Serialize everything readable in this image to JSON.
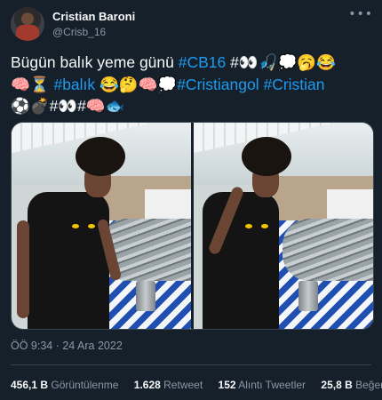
{
  "author": {
    "name": "Cristian Baroni",
    "handle": "@Crisb_16"
  },
  "menu": {
    "more_label": "•••"
  },
  "tweet": {
    "line1_text": "Bügün balık yeme günü ",
    "line1_tag": "#CB16",
    "line1_rest": " #👀🎣💭🥱😂",
    "line2_emoji": "🧠⏳",
    "line2_tags": "#balık",
    "line2_mid": " 😂🤔🧠💭",
    "line2_tags2": "#Cristiangol #Cristian",
    "line3": "⚽💣#👀#🧠🐟"
  },
  "timestamp": {
    "time": "ÖÖ 9:34",
    "sep": " · ",
    "date": "24 Ara 2022"
  },
  "stats": [
    {
      "value": "456,1 B",
      "label": "Görüntülenme"
    },
    {
      "value": "1.628",
      "label": "Retweet"
    },
    {
      "value": "152",
      "label": "Alıntı Tweetler"
    },
    {
      "value": "25,8 B",
      "label": "Beğeni"
    }
  ],
  "colors": {
    "background": "#15202b",
    "link": "#1d9bf0",
    "muted": "#8b98a5",
    "text": "#f7f9f9"
  }
}
